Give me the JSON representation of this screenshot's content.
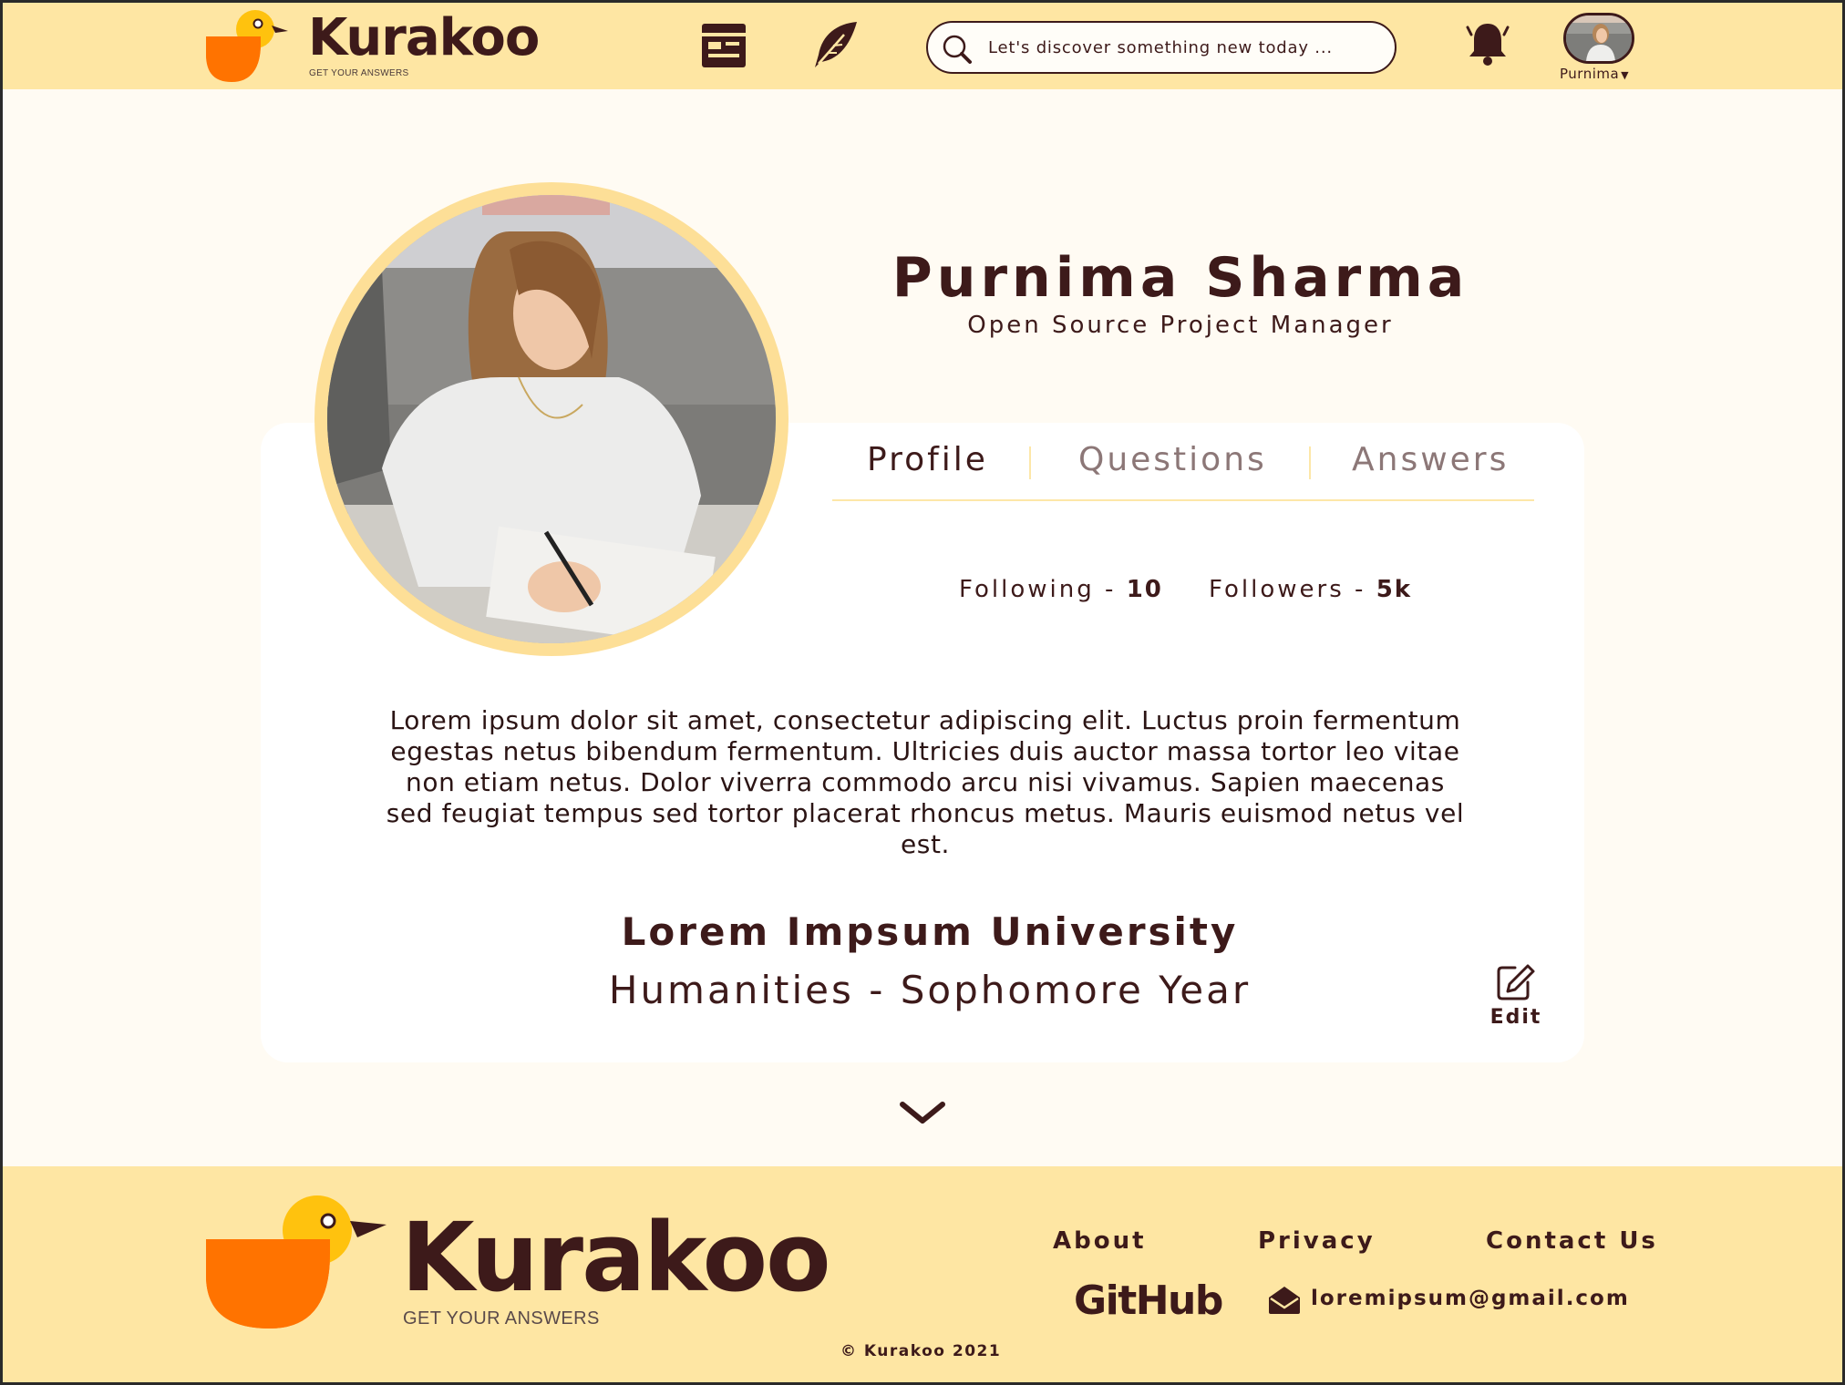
{
  "header": {
    "brand": "Kurakoo",
    "tagline": "GET YOUR ANSWERS",
    "search_placeholder": "Let's discover something new today ...",
    "user_name": "Purnima",
    "icons": [
      "feed-icon",
      "quill-icon",
      "search-icon",
      "bell-icon"
    ]
  },
  "profile": {
    "name": "Purnima Sharma",
    "role": "Open Source Project Manager",
    "tabs": [
      {
        "label": "Profile",
        "active": true
      },
      {
        "label": "Questions",
        "active": false
      },
      {
        "label": "Answers",
        "active": false
      }
    ],
    "following_label": "Following",
    "following_count": "10",
    "followers_label": "Followers",
    "followers_count": "5k",
    "bio": "Lorem ipsum dolor sit amet, consectetur adipiscing elit. Luctus proin fermentum egestas netus bibendum fermentum. Ultricies duis auctor massa tortor leo vitae non etiam netus. Dolor viverra commodo arcu nisi vivamus. Sapien maecenas sed feugiat tempus sed tortor placerat rhoncus metus. Mauris euismod netus vel est.",
    "university": "Lorem Impsum University",
    "major": "Humanities - Sophomore Year",
    "edit_label": "Edit"
  },
  "footer": {
    "brand": "Kurakoo",
    "tagline": "GET YOUR ANSWERS",
    "links": {
      "about": "About",
      "privacy": "Privacy",
      "contact": "Contact Us"
    },
    "github": "GitHub",
    "email": "loremipsum@gmail.com",
    "copyright": "© Kurakoo 2021"
  },
  "colors": {
    "header_bg": "#fee6a3",
    "page_bg": "#fffbf3",
    "text_dark": "#3d1a1a",
    "accent_orange": "#ff7300",
    "accent_yellow": "#ffc20e",
    "ring": "#fddf97"
  }
}
